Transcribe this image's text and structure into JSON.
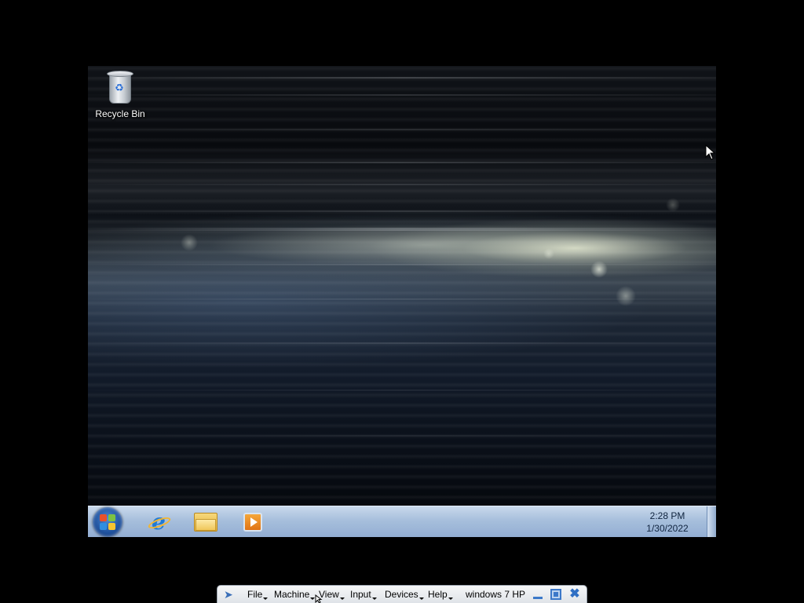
{
  "desktop": {
    "icons": [
      {
        "label": "Recycle Bin",
        "icon": "recycle-bin-icon"
      }
    ]
  },
  "taskbar": {
    "start_icon": "windows-start-orb-icon",
    "pinned": [
      {
        "icon": "internet-explorer-icon"
      },
      {
        "icon": "windows-explorer-folder-icon"
      },
      {
        "icon": "windows-media-player-icon"
      }
    ],
    "clock": {
      "time": "2:28 PM",
      "date": "1/30/2022"
    }
  },
  "vbox_toolbar": {
    "pin_icon": "pushpin-icon",
    "menus": {
      "file": "File",
      "machine": "Machine",
      "view": "View",
      "input": "Input",
      "devices": "Devices",
      "help": "Help"
    },
    "vm_name": "windows 7 HP",
    "window_controls": [
      "minimize-icon",
      "restore-icon",
      "close-icon"
    ]
  },
  "colors": {
    "taskbar_top": "#c9d9ec",
    "taskbar_bottom": "#93aed3",
    "host_background": "#000000",
    "toolbar_background": "#eef0f3",
    "accent_blue": "#3b78c9"
  }
}
